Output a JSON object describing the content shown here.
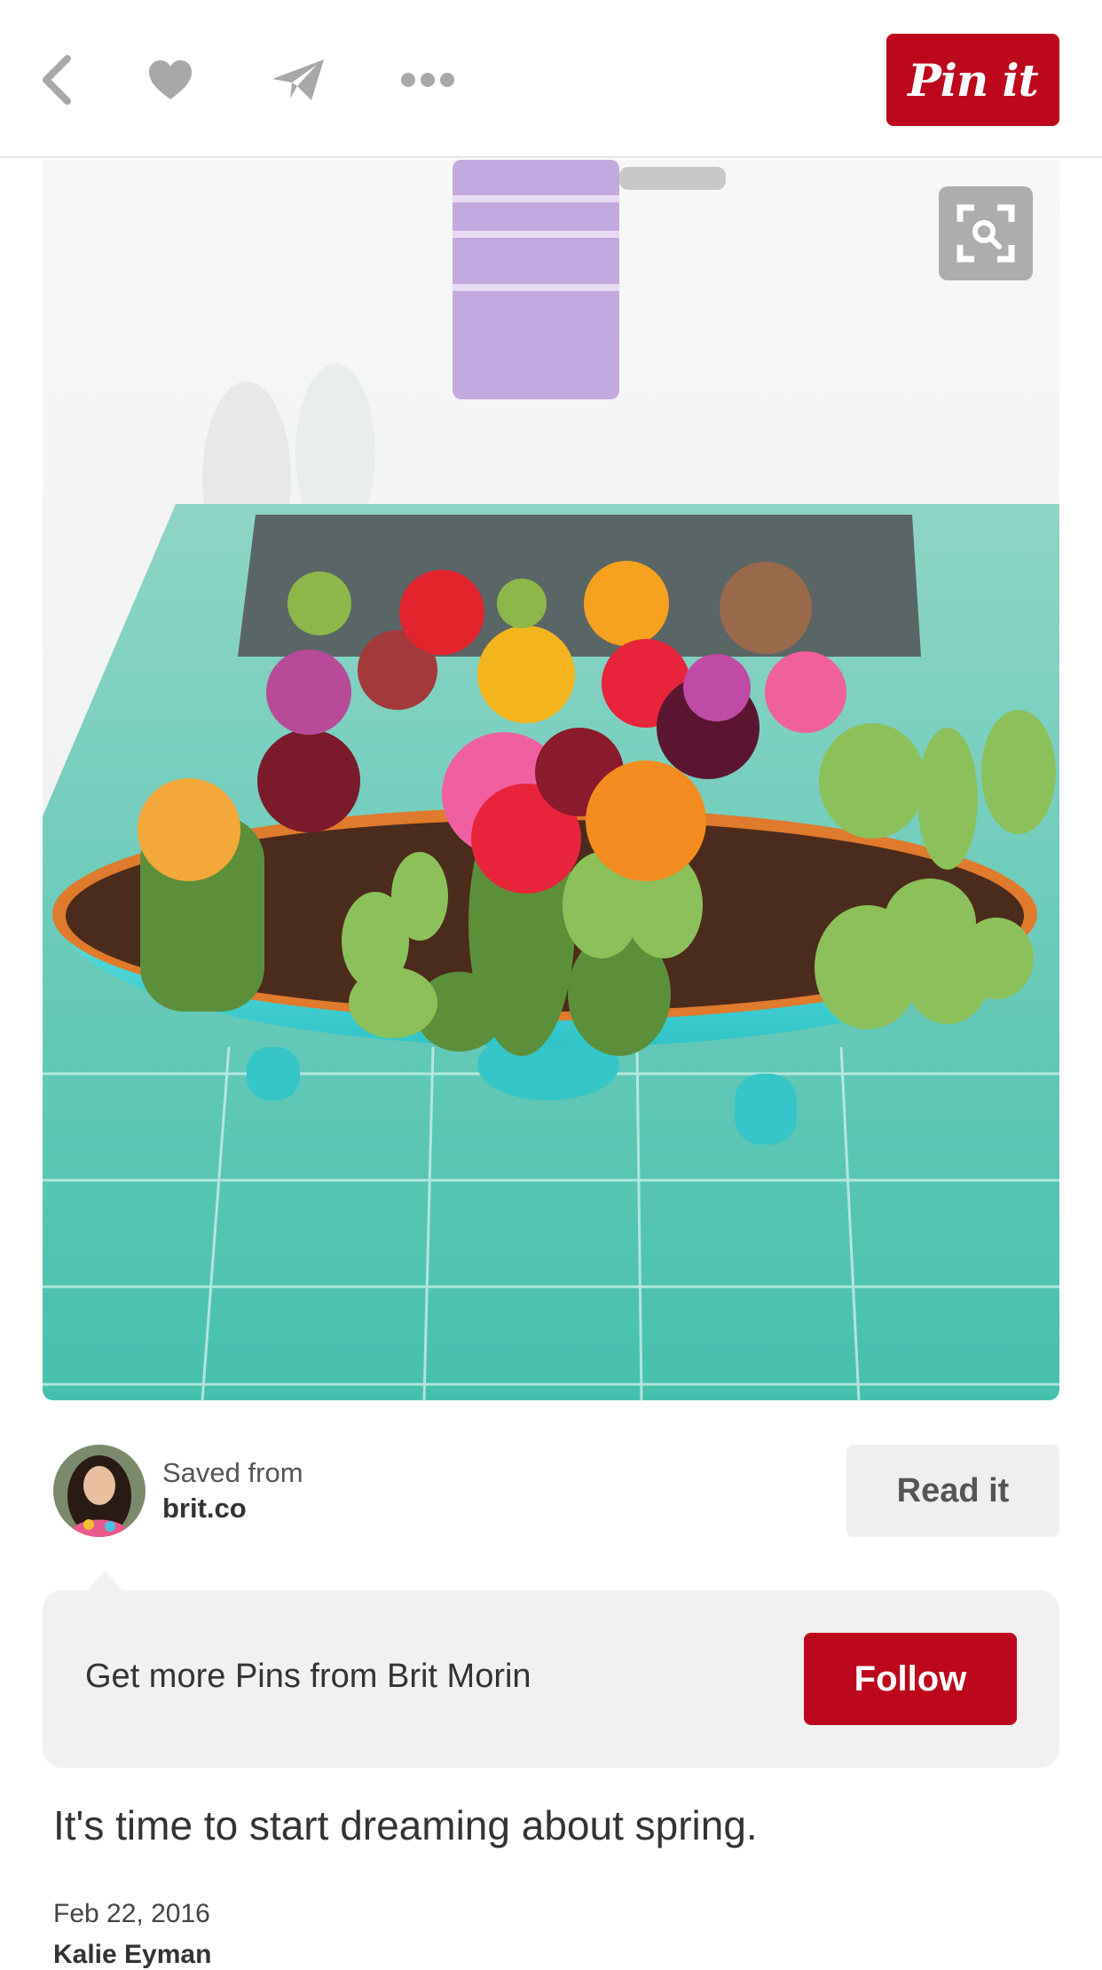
{
  "toolbar": {
    "back_icon": "chevron-left-icon",
    "like_icon": "heart-icon",
    "send_icon": "paper-plane-icon",
    "more_icon": "ellipsis-icon",
    "pin_button": "Pin it"
  },
  "colors": {
    "brand_red": "#bd081c",
    "icon_gray": "#a8a8a8",
    "card_bg": "#f1f1f1"
  },
  "pin": {
    "image_alt": "Colorful cactus arrangement in a turquoise bowl",
    "visual_search_icon": "lens-scan-icon"
  },
  "source": {
    "saved_from_label": "Saved from",
    "domain": "brit.co",
    "read_button": "Read it"
  },
  "follow_card": {
    "text": "Get more Pins from Brit Morin",
    "button": "Follow"
  },
  "description": "It's time to start dreaming about spring.",
  "meta": {
    "date": "Feb 22, 2016",
    "pinner": "Kalie Eyman"
  }
}
